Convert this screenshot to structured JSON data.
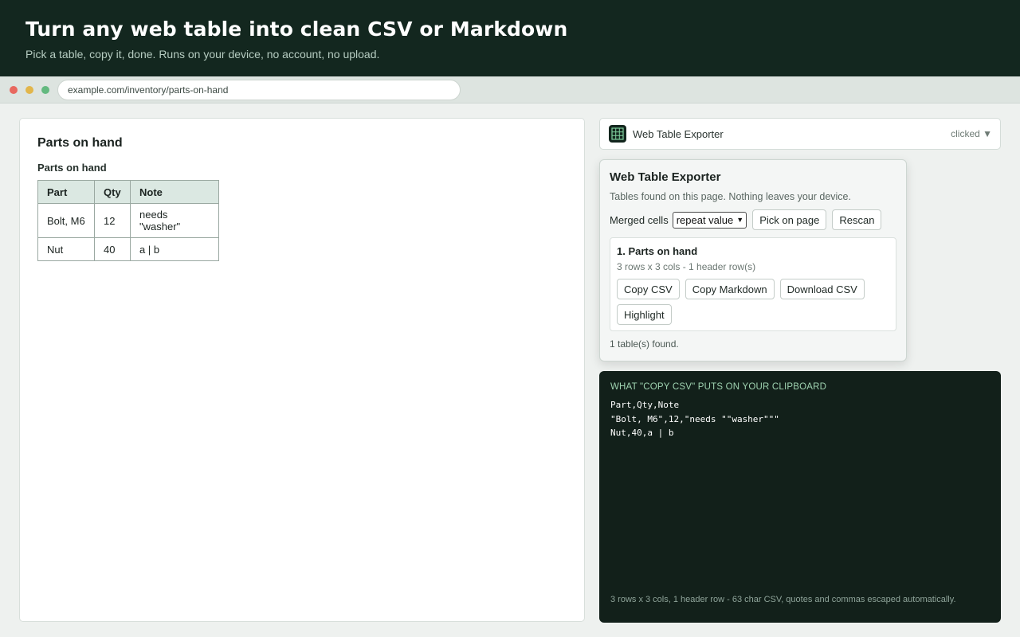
{
  "hero": {
    "title": "Turn any web table into clean CSV or Markdown",
    "subtitle": "Pick a table, copy it, done. Runs on your device, no account, no upload."
  },
  "browser": {
    "url": "example.com/inventory/parts-on-hand"
  },
  "page": {
    "heading": "Parts on hand",
    "caption": "Parts on hand",
    "table": {
      "headers": [
        "Part",
        "Qty",
        "Note"
      ],
      "rows": [
        [
          "Bolt, M6",
          "12",
          "needs \"washer\""
        ],
        [
          "Nut",
          "40",
          "a | b"
        ]
      ]
    }
  },
  "extension": {
    "name": "Web Table Exporter",
    "state": "clicked ▼",
    "icon": "grid-table-icon"
  },
  "popup": {
    "title": "Web Table Exporter",
    "subtitle": "Tables found on this page. Nothing leaves your device.",
    "merged_label": "Merged cells",
    "merged_value": "repeat value",
    "pick_label": "Pick on page",
    "rescan_label": "Rescan",
    "tables": [
      {
        "name": "1. Parts on hand",
        "meta": "3 rows x 3 cols - 1 header row(s)",
        "copy_csv": "Copy CSV",
        "copy_md": "Copy Markdown",
        "download_csv": "Download CSV",
        "highlight": "Highlight"
      }
    ],
    "status": "1 table(s) found."
  },
  "clipboard": {
    "label": "WHAT \"COPY CSV\" PUTS ON YOUR CLIPBOARD",
    "lines": [
      "Part,Qty,Note",
      "\"Bolt, M6\",12,\"needs \"\"washer\"\"\"",
      "Nut,40,a | b"
    ],
    "footer": "3 rows x 3 cols, 1 header row - 63 char CSV, quotes and commas escaped automatically."
  },
  "colors": {
    "hero_bg": "#13271f",
    "code_bg": "#12201a",
    "header_cell_bg": "#dbe8e2",
    "accent_text": "#9fd3b1"
  }
}
